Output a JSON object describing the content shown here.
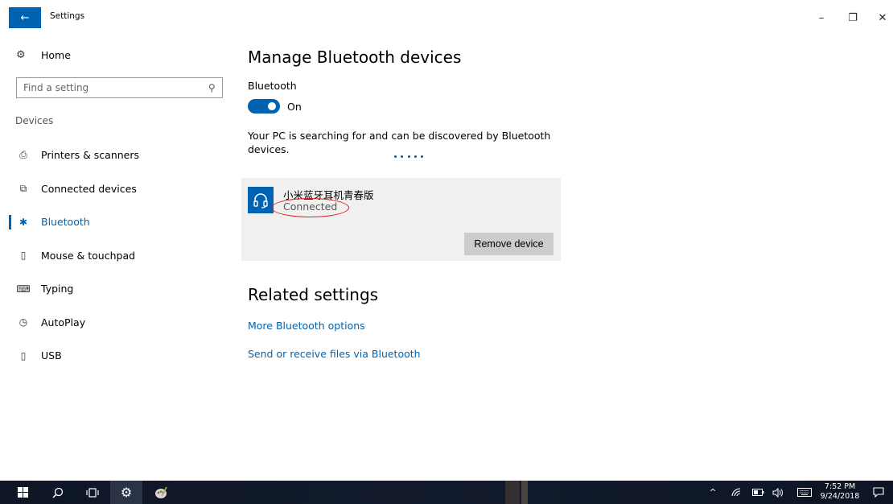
{
  "window": {
    "title": "Settings",
    "back_icon": "←",
    "minimize_icon": "–",
    "restore_icon": "❐",
    "close_icon": "✕"
  },
  "sidebar": {
    "home": {
      "icon": "gear-icon",
      "glyph": "⚙",
      "label": "Home"
    },
    "search": {
      "placeholder": "Find a setting",
      "icon": "search-icon",
      "glyph": "⚲"
    },
    "section_label": "Devices",
    "items": [
      {
        "id": "printers",
        "icon": "printer-icon",
        "glyph": "⎙",
        "label": "Printers & scanners",
        "active": false
      },
      {
        "id": "connected",
        "icon": "connected-devices-icon",
        "glyph": "⧉",
        "label": "Connected devices",
        "active": false
      },
      {
        "id": "bluetooth",
        "icon": "bluetooth-icon",
        "glyph": "✱",
        "label": "Bluetooth",
        "active": true
      },
      {
        "id": "mouse",
        "icon": "mouse-icon",
        "glyph": "▯",
        "label": "Mouse & touchpad",
        "active": false
      },
      {
        "id": "typing",
        "icon": "keyboard-icon",
        "glyph": "⌨",
        "label": "Typing",
        "active": false
      },
      {
        "id": "autoplay",
        "icon": "autoplay-icon",
        "glyph": "◷",
        "label": "AutoPlay",
        "active": false
      },
      {
        "id": "usb",
        "icon": "usb-icon",
        "glyph": "▯",
        "label": "USB",
        "active": false
      }
    ]
  },
  "main": {
    "title": "Manage Bluetooth devices",
    "bluetooth_label": "Bluetooth",
    "toggle_state": "On",
    "accent": "#0063b1",
    "discover_text": "Your PC is searching for and can be discovered by Bluetooth devices.",
    "device": {
      "icon": "headphones-icon",
      "name": "小米蓝牙耳机青春版",
      "status": "Connected",
      "remove_label": "Remove device",
      "highlight_color": "#e01b1b"
    },
    "related_title": "Related settings",
    "links": [
      "More Bluetooth options",
      "Send or receive files via Bluetooth"
    ]
  },
  "taskbar": {
    "clock_time": "7:52 PM",
    "clock_date": "9/24/2018",
    "icons": [
      "start-icon",
      "search-icon",
      "task-view-icon",
      "settings-icon",
      "paint-icon"
    ],
    "tray": {
      "chevron": "^",
      "wifi": "◠",
      "battery": "▭",
      "volume": "🕪",
      "keyboard": "⌨",
      "notification": "▢"
    }
  }
}
